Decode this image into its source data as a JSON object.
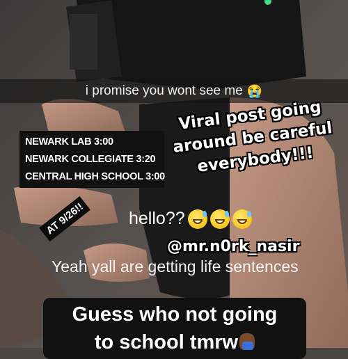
{
  "caption_bar": {
    "text": "i promise you wont see me",
    "emoji_icon": "loudly-crying-face-icon"
  },
  "schedule": [
    "NEWARK LAB 3:00",
    "NEWARK COLLEGIATE 3:20",
    "CENTRAL HIGH SCHOOL 3:00"
  ],
  "viral_note": {
    "lines": [
      "Viral post going",
      "around be careful",
      "everybody!!!"
    ]
  },
  "date_tag": "AT 9/26!!",
  "hello": {
    "text": "hello??",
    "emoji_icon": "grinning-face-with-sweat-icon",
    "emoji_count": 3
  },
  "username": "@mr.n0rk_nasir",
  "life_line": "Yeah yall are getting life sentences",
  "guess_box": {
    "lines": [
      "Guess who not going",
      "to school tmrw"
    ],
    "emoji_icon": "person-facepalming-icon"
  },
  "colors": {
    "caption_bg": "#141414",
    "label_bg": "#111111",
    "text": "#ffffff"
  }
}
